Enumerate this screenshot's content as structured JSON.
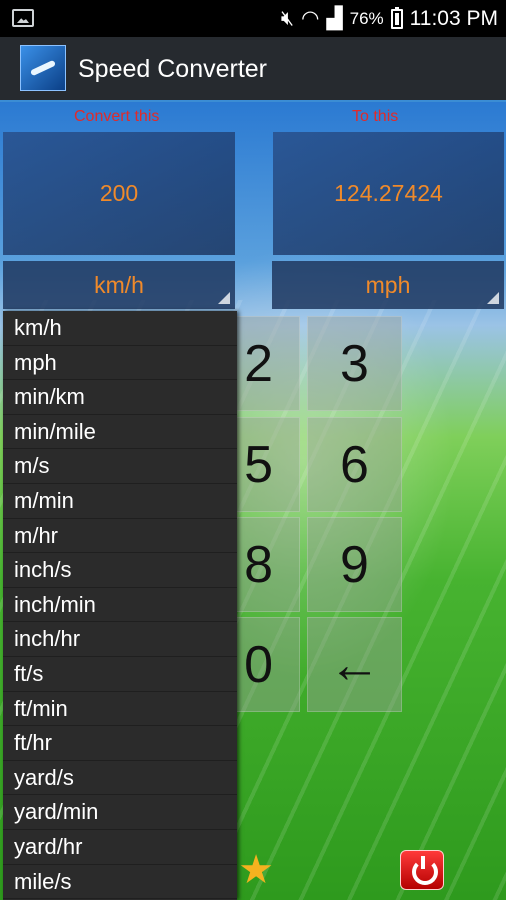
{
  "status_bar": {
    "battery": "76%",
    "time": "11:03 PM"
  },
  "app": {
    "title": "Speed Converter"
  },
  "labels": {
    "from": "Convert this",
    "to": "To this"
  },
  "values": {
    "from": "200",
    "to": "124.27424"
  },
  "units": {
    "from_selected": "km/h",
    "to_selected": "mph"
  },
  "keypad": {
    "k2": "2",
    "k3": "3",
    "k5": "5",
    "k6": "6",
    "k8": "8",
    "k9": "9",
    "k0": "0",
    "back": "←"
  },
  "dropdown_items": [
    "km/h",
    "mph",
    "min/km",
    "min/mile",
    "m/s",
    "m/min",
    "m/hr",
    "inch/s",
    "inch/min",
    "inch/hr",
    "ft/s",
    "ft/min",
    "ft/hr",
    "yard/s",
    "yard/min",
    "yard/hr",
    "mile/s"
  ],
  "colors": {
    "value_text": "#f08a2a",
    "label_text": "#e02a2a",
    "accent": "#3b8dd4"
  }
}
